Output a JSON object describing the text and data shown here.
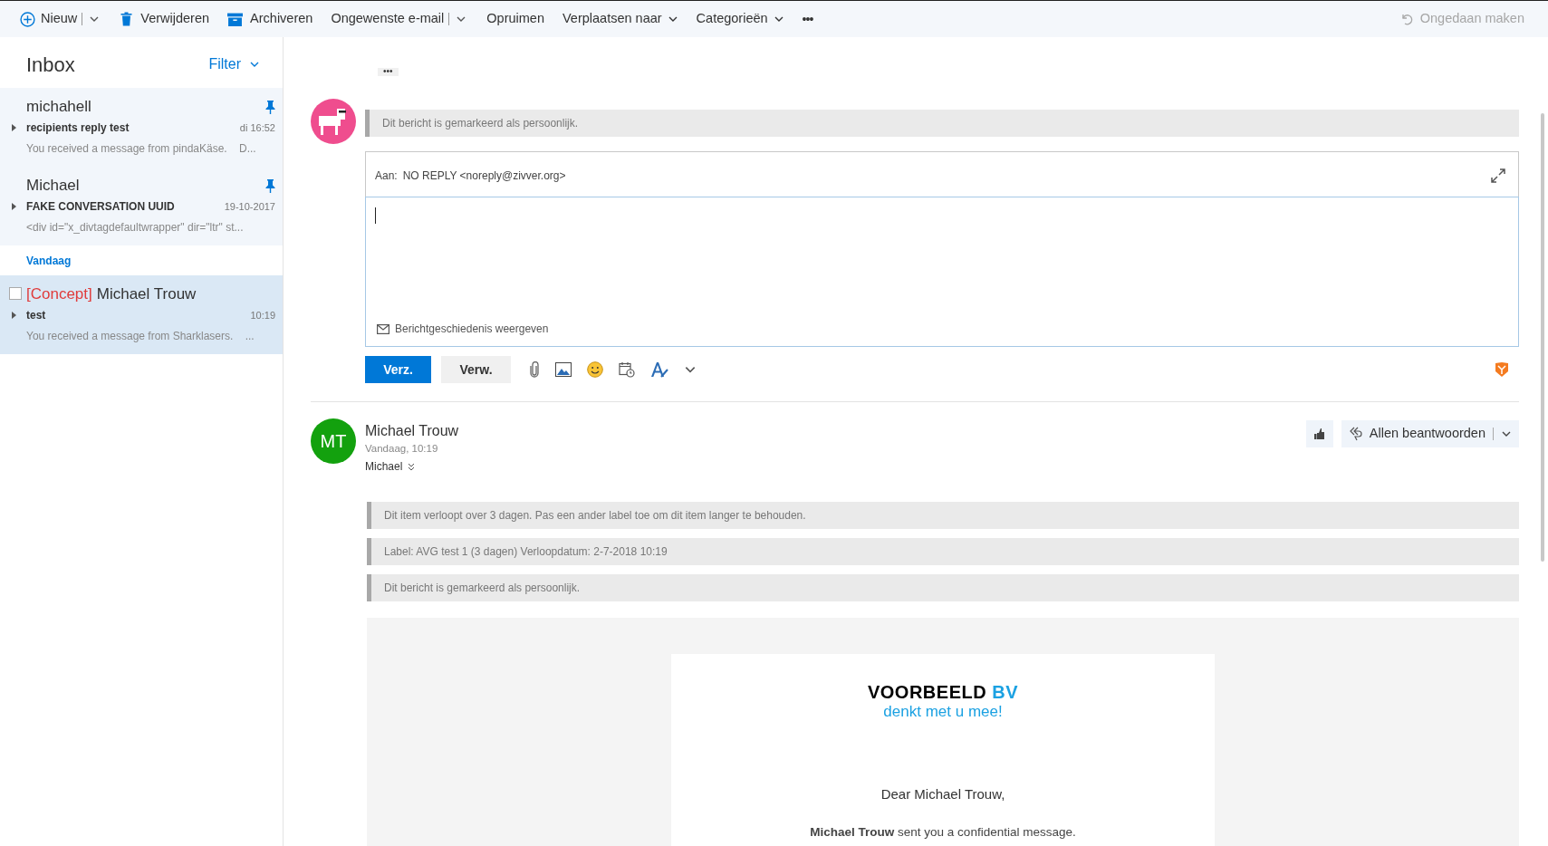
{
  "toolbar": {
    "items": [
      {
        "kind": "split",
        "label": "Nieuw"
      },
      {
        "kind": "plain",
        "label": "Verwijderen"
      },
      {
        "kind": "plain",
        "label": "Archiveren"
      },
      {
        "kind": "split",
        "label": "Ongewenste e-mail"
      },
      {
        "kind": "plain",
        "label": "Opruimen"
      },
      {
        "kind": "menu",
        "label": "Verplaatsen naar"
      },
      {
        "kind": "menu",
        "label": "Categorieën"
      },
      {
        "kind": "more",
        "label": "•••"
      }
    ],
    "undo": {
      "label": "Ongedaan maken",
      "disabled": true
    }
  },
  "inbox": {
    "title": "Inbox",
    "filter": "Filter",
    "groups": [
      {
        "items": [
          {
            "sender": "michahell",
            "subject": "recipients reply test",
            "time": "di 16:52",
            "preview": "You received a message from pindaKäse.    D...",
            "pinned": true,
            "selected": false
          },
          {
            "sender": "Michael",
            "subject": "FAKE CONVERSATION UUID",
            "time": "19-10-2017",
            "preview": "<div id=\"x_divtagdefaultwrapper\" dir=\"ltr\" st...",
            "pinned": true,
            "selected": false
          }
        ]
      },
      {
        "header": "Vandaag",
        "items": [
          {
            "draft_tag": "[Concept]",
            "sender": "Michael Trouw",
            "subject": "test",
            "time": "10:19",
            "preview": "You received a message from Sharklasers.    ...",
            "pinned": false,
            "selected": true
          }
        ]
      }
    ]
  },
  "reading": {
    "more": "•••",
    "compose": {
      "notice": "Dit bericht is gemarkeerd als persoonlijk.",
      "to_label": "Aan:",
      "to_value": "NO REPLY <noreply@zivver.org>",
      "history_link": "Berichtgeschiedenis weergeven",
      "send": "Verz.",
      "discard": "Verw."
    },
    "message": {
      "initials": "MT",
      "sender": "Michael Trouw",
      "date": "Vandaag, 10:19",
      "recipient": "Michael",
      "reply_all": "Allen beantwoorden",
      "notices": [
        "Dit item verloopt over 3 dagen. Pas een ander label toe om dit item langer te behouden.",
        "Label: AVG test 1 (3 dagen) Verloopdatum: 2-7-2018 10:19",
        "Dit bericht is gemarkeerd als persoonlijk."
      ],
      "body": {
        "brand": "VOORBEELD",
        "brand_accent": "BV",
        "tagline": "denkt met u mee!",
        "greeting": "Dear Michael Trouw,",
        "sentence": "**Michael Trouw** sent you a confidential message."
      }
    }
  }
}
